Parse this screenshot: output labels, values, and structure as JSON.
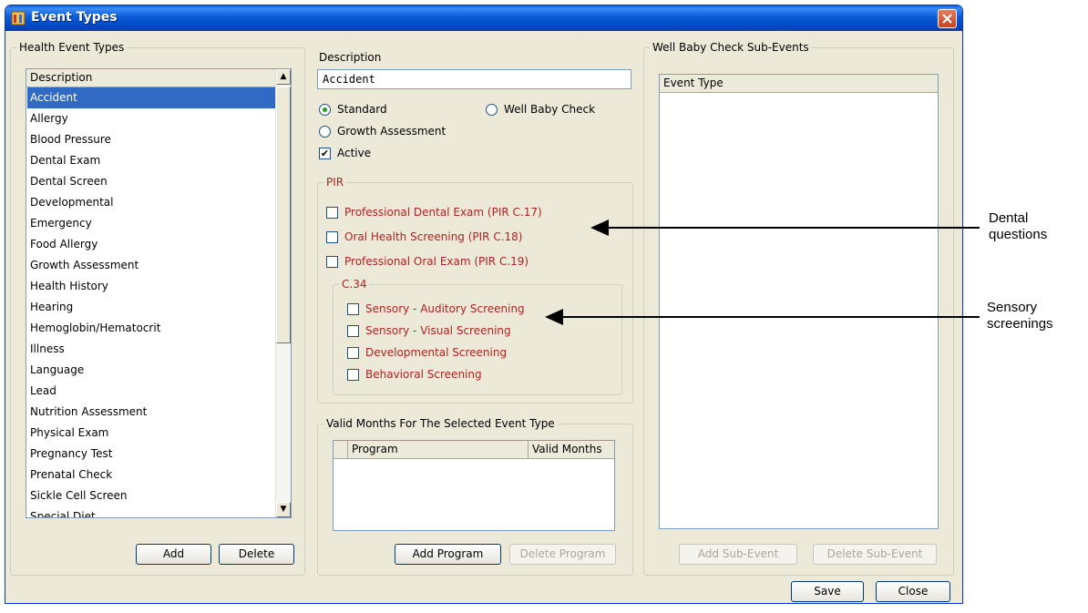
{
  "window": {
    "title": "Event Types"
  },
  "health_event_types": {
    "legend": "Health Event Types",
    "column_header": "Description",
    "items": [
      "Accident",
      "Allergy",
      "Blood Pressure",
      "Dental Exam",
      "Dental Screen",
      "Developmental",
      "Emergency",
      "Food Allergy",
      "Growth Assessment",
      "Health History",
      "Hearing",
      "Hemoglobin/Hematocrit",
      "Illness",
      "Language",
      "Lead",
      "Nutrition Assessment",
      "Physical Exam",
      "Pregnancy Test",
      "Prenatal Check",
      "Sickle Cell Screen",
      "Special Diet"
    ],
    "selected_index": 0,
    "add_button": "Add",
    "delete_button": "Delete"
  },
  "details": {
    "description_label": "Description",
    "description_value": "Accident",
    "radio_standard": "Standard",
    "radio_well_baby": "Well Baby Check",
    "radio_growth": "Growth Assessment",
    "selected_radio": "Standard",
    "active_label": "Active",
    "active_checked": true,
    "pir": {
      "legend": "PIR",
      "items": [
        {
          "label": "Professional Dental Exam (PIR C.17)",
          "checked": false
        },
        {
          "label": "Oral Health Screening (PIR C.18)",
          "checked": false
        },
        {
          "label": "Professional Oral Exam (PIR C.19)",
          "checked": false
        }
      ],
      "c34": {
        "legend": "C.34",
        "items": [
          {
            "label": "Sensory - Auditory Screening",
            "checked": false
          },
          {
            "label": "Sensory - Visual Screening",
            "checked": false
          },
          {
            "label": "Developmental Screening",
            "checked": false
          },
          {
            "label": "Behavioral Screening",
            "checked": false
          }
        ]
      }
    }
  },
  "valid_months": {
    "legend": "Valid Months For The Selected Event Type",
    "col_program": "Program",
    "col_months": "Valid Months",
    "add_button": "Add Program",
    "delete_button": "Delete Program"
  },
  "sub_events": {
    "legend": "Well Baby Check Sub-Events",
    "column_header": "Event Type",
    "add_button": "Add Sub-Event",
    "delete_button": "Delete Sub-Event"
  },
  "footer": {
    "save_button": "Save",
    "close_button": "Close"
  },
  "annotations": {
    "dental_line1": "Dental",
    "dental_line2": "questions",
    "sensory_line1": "Sensory",
    "sensory_line2": "screenings"
  },
  "colors": {
    "pir_red": "#b22222",
    "selection": "#316ac5",
    "titlebar": "#0a5bd8"
  }
}
